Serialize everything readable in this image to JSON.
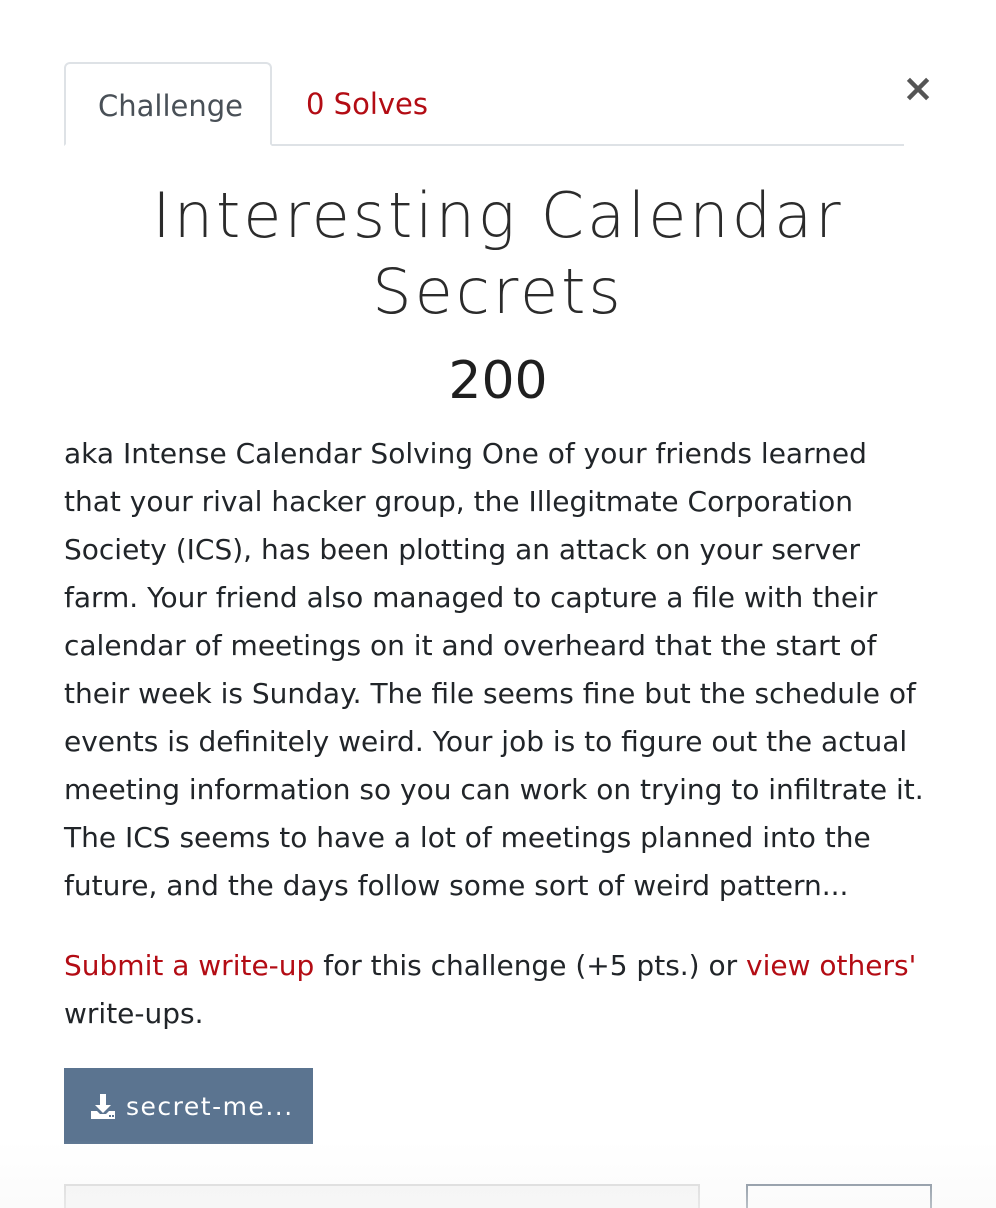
{
  "tabs": {
    "challenge_label": "Challenge",
    "solves_label": "0 Solves"
  },
  "close_label": "×",
  "challenge": {
    "name": "Interesting Calendar Secrets",
    "value": "200",
    "description": "aka Intense Calendar Solving One of your friends learned that your rival hacker group, the Illegitmate Corporation Society (ICS), has been plotting an attack on your server farm. Your friend also managed to capture a file with their calendar of meetings on it and overheard that the start of their week is Sunday. The file seems fine but the schedule of events is definitely weird. Your job is to figure out the actual meeting information so you can work on trying to infiltrate it. The ICS seems to have a lot of meetings planned into the future, and the days follow some sort of weird pattern..."
  },
  "writeup": {
    "submit_link": "Submit a write-up",
    "middle_text": " for this challenge (+5 pts.) or ",
    "view_link": "view others'",
    "end_text": " write-ups."
  },
  "file": {
    "label": "secret-me...",
    "icon": "download-icon"
  },
  "colors": {
    "accent": "#b30c14",
    "button": "#5b7490"
  }
}
